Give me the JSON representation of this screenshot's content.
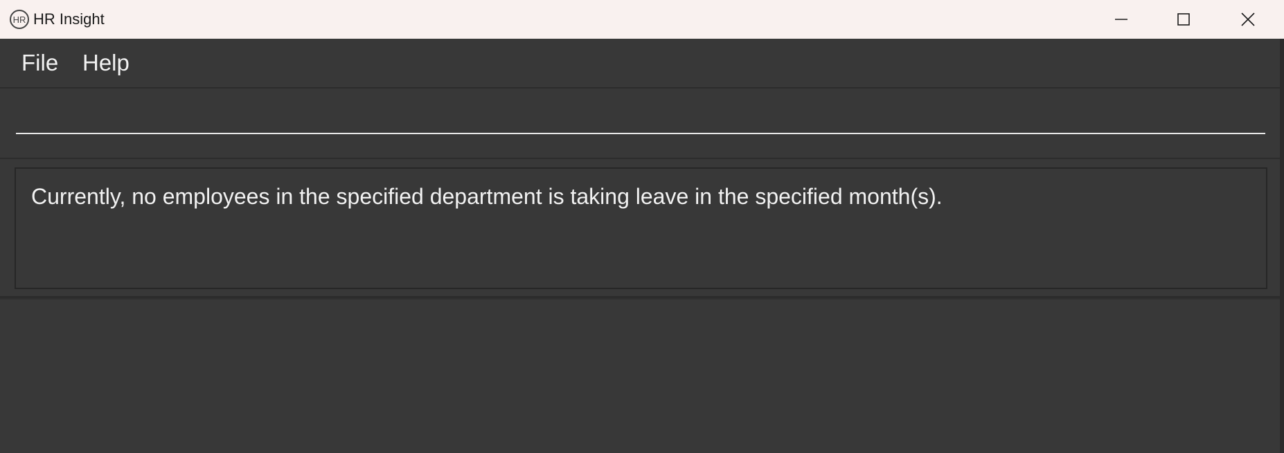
{
  "window": {
    "title": "HR Insight",
    "logo_icon": "hr-logo-icon"
  },
  "menu": {
    "items": [
      {
        "label": "File"
      },
      {
        "label": "Help"
      }
    ]
  },
  "command_box": {
    "value": "",
    "placeholder": ""
  },
  "result": {
    "message": "Currently, no employees in the specified department is taking leave in the specified month(s)."
  },
  "colors": {
    "titlebar_bg": "#f9f1ef",
    "app_bg": "#383838",
    "text": "#f2f2f2",
    "border": "#2c2c2c"
  }
}
